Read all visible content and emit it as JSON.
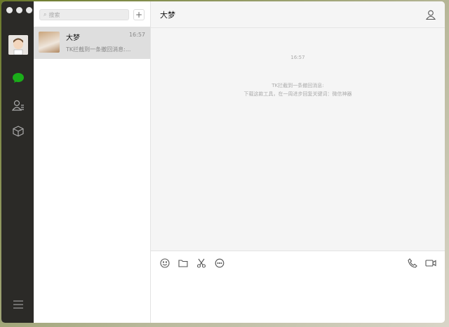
{
  "search": {
    "placeholder": "搜索"
  },
  "conversations": [
    {
      "name": "大梦",
      "time": "16:57",
      "preview": "TK拦截到一条撤回消息:..."
    }
  ],
  "chat": {
    "title": "大梦",
    "timestamp": "16:57",
    "system_lines": [
      "TK拦截到一条撤回消息:",
      "下载这款工具，在一周进步回复关键词：微信神器"
    ]
  },
  "colors": {
    "accent": "#1aad19",
    "sidebar": "#2b2a27"
  }
}
